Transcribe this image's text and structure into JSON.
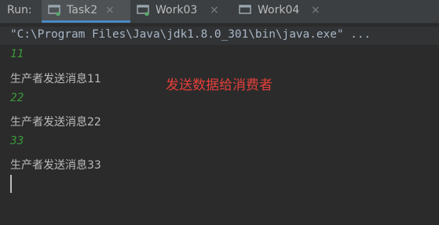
{
  "run_label": "Run:",
  "tabs": [
    {
      "label": "Task2",
      "icon": "run-config-icon",
      "active": true
    },
    {
      "label": "Work03",
      "icon": "run-config-icon",
      "active": false
    },
    {
      "label": "Work04",
      "icon": "run-config-icon",
      "active": false
    }
  ],
  "close_glyph": "×",
  "console": {
    "command": "\"C:\\Program Files\\Java\\jdk1.8.0_301\\bin\\java.exe\" ...",
    "lines": [
      {
        "text": "11",
        "kind": "input"
      },
      {
        "text": "生产者发送消息11",
        "kind": "output"
      },
      {
        "text": "22",
        "kind": "input"
      },
      {
        "text": "生产者发送消息22",
        "kind": "output"
      },
      {
        "text": "33",
        "kind": "input"
      },
      {
        "text": "生产者发送消息33",
        "kind": "output"
      }
    ],
    "annotation": "发送数据给消费者"
  },
  "colors": {
    "accent": "#4a88c7",
    "input_text": "#3a9a3a",
    "annotation": "#e43f3a",
    "running_indicator": "#59a869"
  }
}
